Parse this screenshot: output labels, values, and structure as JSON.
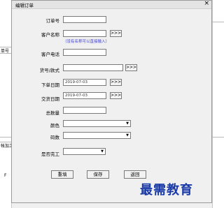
{
  "background": {
    "left_text_1": "单号",
    "left_text_2": "帐加工",
    "left_text_3": "F"
  },
  "dialog": {
    "title": "编辑订单",
    "close_glyph": "×",
    "more_glyph": ">>>",
    "fields": {
      "order_no": {
        "label": "订单号",
        "value": ""
      },
      "customer_name": {
        "label": "客户名称",
        "value": "",
        "hint": "（没有名称可以直接输入）"
      },
      "customer_phone": {
        "label": "客户电话",
        "value": ""
      },
      "model": {
        "label": "货号/款式",
        "value": ""
      },
      "order_date": {
        "label": "下单日期",
        "value": "2019-07-03"
      },
      "delivery_date": {
        "label": "交货日期",
        "value": "2019-07-03"
      },
      "total_qty": {
        "label": "总数量",
        "value": ""
      },
      "color": {
        "label": "颜色",
        "value": ""
      },
      "size": {
        "label": "码数",
        "value": ""
      },
      "finished": {
        "label": "是否完工",
        "value": ""
      }
    },
    "buttons": {
      "reset": "重填",
      "save": "保存",
      "back": "返回"
    }
  },
  "watermark": "最需教育"
}
